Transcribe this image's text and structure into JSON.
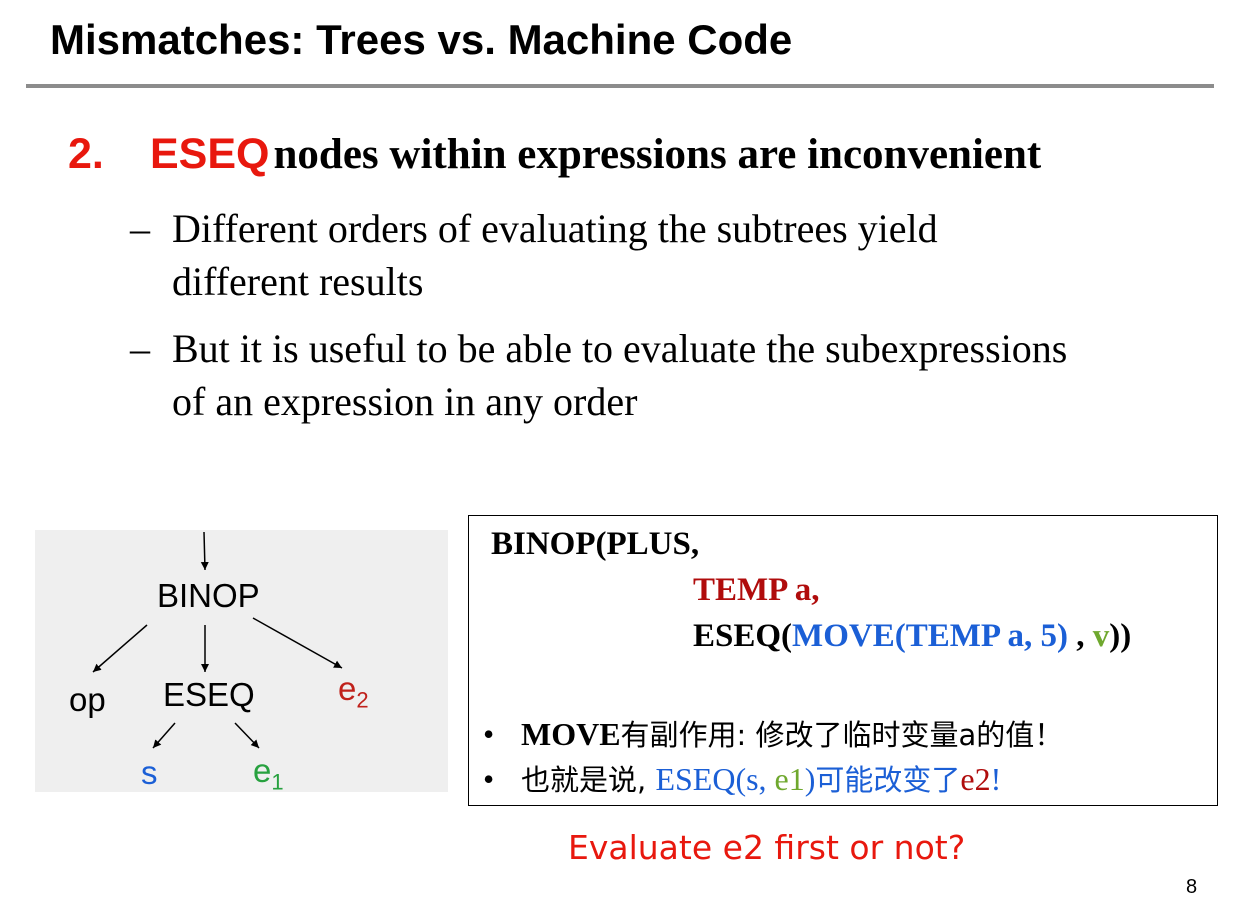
{
  "title": "Mismatches: Trees vs. Machine Code",
  "point": {
    "number": "2.",
    "keyword": "ESEQ",
    "text": "nodes within expressions are inconvenient"
  },
  "subpoints": [
    {
      "dash": "–",
      "line1": "Different orders of evaluating the subtrees yield",
      "line2": "different results"
    },
    {
      "dash": "–",
      "line1": "But it is useful to be able to evaluate the subexpressions",
      "line2": "of an expression in any order"
    }
  ],
  "tree": {
    "binop": "BINOP",
    "op": "op",
    "eseq": "ESEQ",
    "e2": "e",
    "e2_sub": "2",
    "s": "s",
    "e1": "e",
    "e1_sub": "1",
    "colors": {
      "e2": "#c0211b",
      "s": "#1b5fd6",
      "e1": "#27a13f"
    }
  },
  "code": {
    "line1": "BINOP(PLUS,",
    "line2": "TEMP a,",
    "line3_pre": "ESEQ(",
    "line3_move": "MOVE(TEMP a, 5)",
    "line3_comma": " , ",
    "line3_v": "v",
    "line3_post": "))"
  },
  "notes": {
    "bullet": "•",
    "b1_move": "MOVE",
    "b1_text": "有副作用: 修改了临时变量a的值！",
    "b2_a": "也就是说, ",
    "b2_eseq": "ESEQ(s, ",
    "b2_e1": "e1",
    "b2_close": ")",
    "b2_mid": "可能改变了",
    "b2_e2": "e2",
    "b2_end": "!"
  },
  "question": "Evaluate e2 first or not?",
  "page_number": "8"
}
